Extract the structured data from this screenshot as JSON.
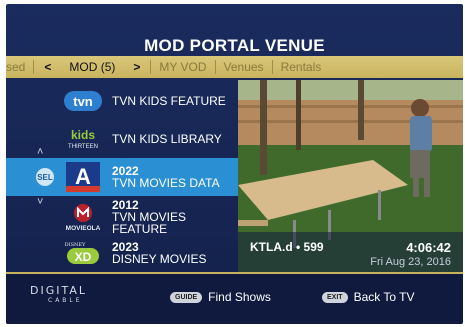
{
  "title": "MOD PORTAL VENUE",
  "nav": {
    "items": [
      {
        "label": "sed",
        "state": "dim"
      },
      {
        "label": "MOD (5)",
        "state": "active"
      },
      {
        "label": "MY VOD",
        "state": "dim"
      },
      {
        "label": "Venues",
        "state": "dim"
      },
      {
        "label": "Rentals",
        "state": "dim"
      }
    ],
    "left_arrow": "<",
    "right_arrow": ">"
  },
  "list": {
    "rows": [
      {
        "logo": "tvn",
        "name": "TVN KIDS FEATURE"
      },
      {
        "logo_top": "kids",
        "logo_bottom": "THIRTEEN",
        "name": "TVN KIDS LIBRARY"
      },
      {
        "logo": "A",
        "year": "2022",
        "name": "TVN MOVIES DATA",
        "selected": true
      },
      {
        "logo_caption": "MOVIEOLA",
        "year": "2012",
        "name": "TVN MOVIES FEATURE"
      },
      {
        "logo_top": "DISNEY",
        "logo": "XD",
        "year": "2023",
        "name": "DISNEY MOVIES"
      }
    ],
    "sel_badge": "SEL",
    "up_chevron": "˄",
    "down_chevron": "˅"
  },
  "preview": {
    "channel": "KTLA.d • 599",
    "time": "4:06:42",
    "date": "Fri Aug 23, 2016"
  },
  "footer": {
    "brand_top": "DIGITAL",
    "brand_bottom": "CABLE",
    "guide_key": "GUIDE",
    "guide_label": "Find Shows",
    "exit_key": "EXIT",
    "exit_label": "Back To TV"
  },
  "colors": {
    "background": "#1a2b5e",
    "selection": "#2b8fd3",
    "nav_bar": "#d4c06c",
    "accent_line": "#c9b45e"
  }
}
